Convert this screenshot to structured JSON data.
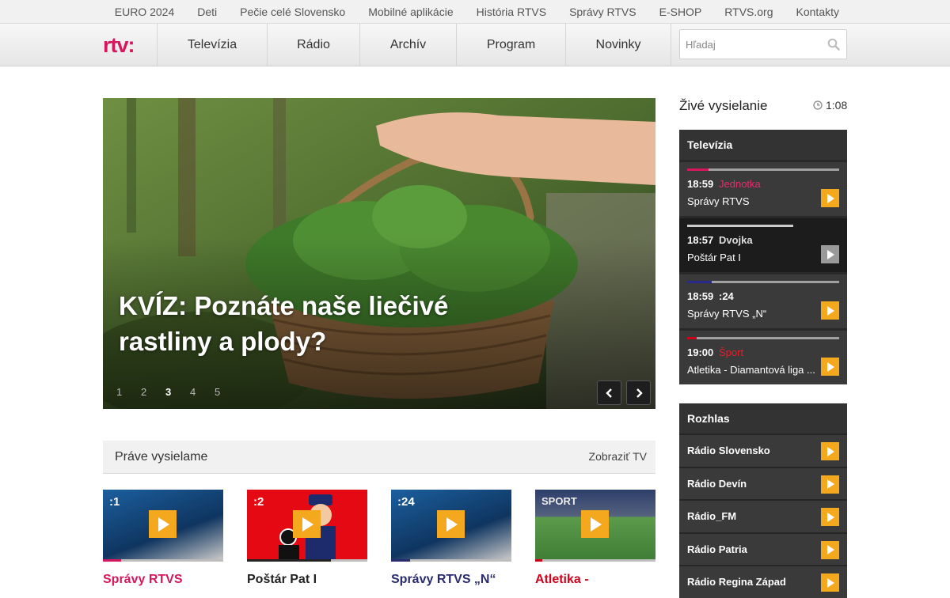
{
  "topbar": {
    "links": [
      "EURO 2024",
      "Deti",
      "Pečie celé Slovensko",
      "Mobilné aplikácie",
      "História RTVS",
      "Správy RTVS",
      "E-SHOP",
      "RTVS.org",
      "Kontakty"
    ]
  },
  "header": {
    "logo": "rtv:",
    "nav": [
      "Televízia",
      "Rádio",
      "Archív",
      "Program",
      "Novinky"
    ],
    "search_placeholder": "Hľadaj"
  },
  "hero": {
    "title": "KVÍZ: Poznáte naše liečivé rastliny a plody?",
    "pages": [
      "1",
      "2",
      "3",
      "4",
      "5"
    ],
    "active_page": 3
  },
  "now": {
    "title": "Práve vysielame",
    "link": "Zobraziť TV",
    "tiles": [
      {
        "channel": ":1",
        "name": "Správy RTVS",
        "color": "#d6175d",
        "progress": 0.15,
        "bg": "news"
      },
      {
        "channel": ":2",
        "name": "Poštár Pat I",
        "color": "#222222",
        "progress": 0.7,
        "bg": "red"
      },
      {
        "channel": ":24",
        "name": "Správy RTVS „N“",
        "color": "#2a2a6e",
        "progress": 0.16,
        "bg": "news"
      },
      {
        "channel": "SPORT",
        "name": "Atletika -",
        "color": "#d0021b",
        "progress": 0.06,
        "bg": "sport"
      }
    ]
  },
  "sidebar": {
    "live_title": "Živé vysielanie",
    "clock": "1:08",
    "tv_title": "Televízia",
    "tv": [
      {
        "time": "18:59",
        "channel": "Jednotka",
        "show": "Správy RTVS",
        "color": "#d6175d",
        "progress": 0.14,
        "dark": false,
        "active": true
      },
      {
        "time": "18:57",
        "channel": "Dvojka",
        "show": "Poštár Pat I",
        "color": "#cccccc",
        "progress": 0.7,
        "dark": true,
        "active": false
      },
      {
        "time": "18:59",
        "channel": ":24",
        "show": "Správy RTVS „N“",
        "color": "#2a2a8a",
        "progress": 0.16,
        "dark": false,
        "active": true
      },
      {
        "time": "19:00",
        "channel": "Šport",
        "show": "Atletika - Diamantová liga ...",
        "color": "#d0021b",
        "progress": 0.06,
        "dark": false,
        "active": true
      }
    ],
    "radio_title": "Rozhlas",
    "radio": [
      "Rádio Slovensko",
      "Rádio Devín",
      "Rádio_FM",
      "Rádio Patria",
      "Rádio Regina Západ"
    ]
  }
}
